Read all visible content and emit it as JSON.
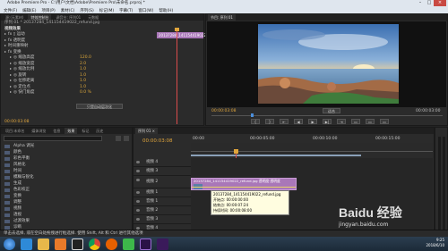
{
  "window": {
    "title": "Adobe Premiere Pro - C:\\用户\\文档\\Adobe\\Premiere Pro\\未命名.prproj *",
    "menu": [
      "文件(F)",
      "编辑(E)",
      "项目(P)",
      "素材(C)",
      "序列(S)",
      "标记(M)",
      "字幕(T)",
      "窗口(W)",
      "帮助(H)"
    ]
  },
  "effect_controls": {
    "tabs": [
      "源:(无素材)",
      "特效控制台",
      "调音台: 序列01",
      "元数据"
    ],
    "clip_path": "序列 01 * 20137284_141154419022_refund.jpg",
    "clip_label": "20137284_141154419022",
    "section_video": "视频效果",
    "rows": [
      {
        "label": "fx ▯ 运动",
        "value": ""
      },
      {
        "label": "fx 透明度",
        "value": ""
      },
      {
        "label": "时间重映射",
        "value": ""
      },
      {
        "label": "fx 变换",
        "value": ""
      },
      {
        "label": "◎ 缩放高度",
        "value": "120.0"
      },
      {
        "label": "◎ 缩放宽度",
        "value": "2.0"
      },
      {
        "label": "◎ 缩放比例",
        "value": "1.0"
      },
      {
        "label": "◎ 旋转",
        "value": "1.0"
      },
      {
        "label": "◎ 位移距离",
        "value": "1.0"
      },
      {
        "label": "◎ 定位点",
        "value": "1.0"
      },
      {
        "label": "◎ 快门角度",
        "value": "0.0 %"
      }
    ],
    "dropdown": "只是自动层次化",
    "timecode": "00:00:03:08"
  },
  "program_monitor": {
    "tabs": [
      "节目: 序列 01"
    ],
    "timecode_left": "00:00:03:08",
    "fit": "适合",
    "timecode_right": "00:00:03:00",
    "transport": [
      "{",
      "}",
      "⇤",
      "◀",
      "▶",
      "▶|",
      "⇥",
      "▭",
      "▭",
      "▭"
    ]
  },
  "project": {
    "tabs": [
      "项目:未命名",
      "媒体浏览",
      "信息",
      "效果",
      "标记",
      "历史"
    ],
    "search_placeholder": "",
    "items": [
      "Alpha 调光",
      "颜色",
      "彩色平衡",
      "风格化",
      "时间",
      "模糊与锐化",
      "生成",
      "色彩校正",
      "变换",
      "调整",
      "视频",
      "透视",
      "过渡效果",
      "诊断"
    ]
  },
  "timeline": {
    "tab": "序列 01 ×",
    "timecode": "00:00:03:08",
    "ruler": [
      "00:00",
      "00:00:05:00",
      "00:00:10:00",
      "00:00:15:00"
    ],
    "tracks": [
      "视频 4",
      "视频 3",
      "视频 2",
      "视频 1",
      "音频 1",
      "音频 2",
      "音频 3",
      "音频 4",
      "主音轨"
    ],
    "clip_title": "20137284_141154419022_refund.jpg 透明度·透明度",
    "clip_label_short": "20137284_141154419022_refund.jpg",
    "tooltip": {
      "name": "20137284_141154419022_refund.jpg",
      "start": "开始点: 00:00:00:00",
      "end": "结束点: 00:00:07:24",
      "duration": "持续时间: 00:00:08:00"
    }
  },
  "status_bar": {
    "text": "单击去选择, 或在空白处拖拽进行框选择. 使用 Shift, Alt 和 Ctrl 进行其他选项"
  },
  "taskbar": {
    "time": "9:25",
    "date": "2018/6/10",
    "watermark": "Baidu 经验",
    "watermark_url": "jingyan.baidu.com"
  },
  "colors": {
    "accent": "#e0a53c",
    "clip": "#a977b8",
    "playhead": "#d94d4d",
    "timeline_bar": "#4b8fdc"
  }
}
